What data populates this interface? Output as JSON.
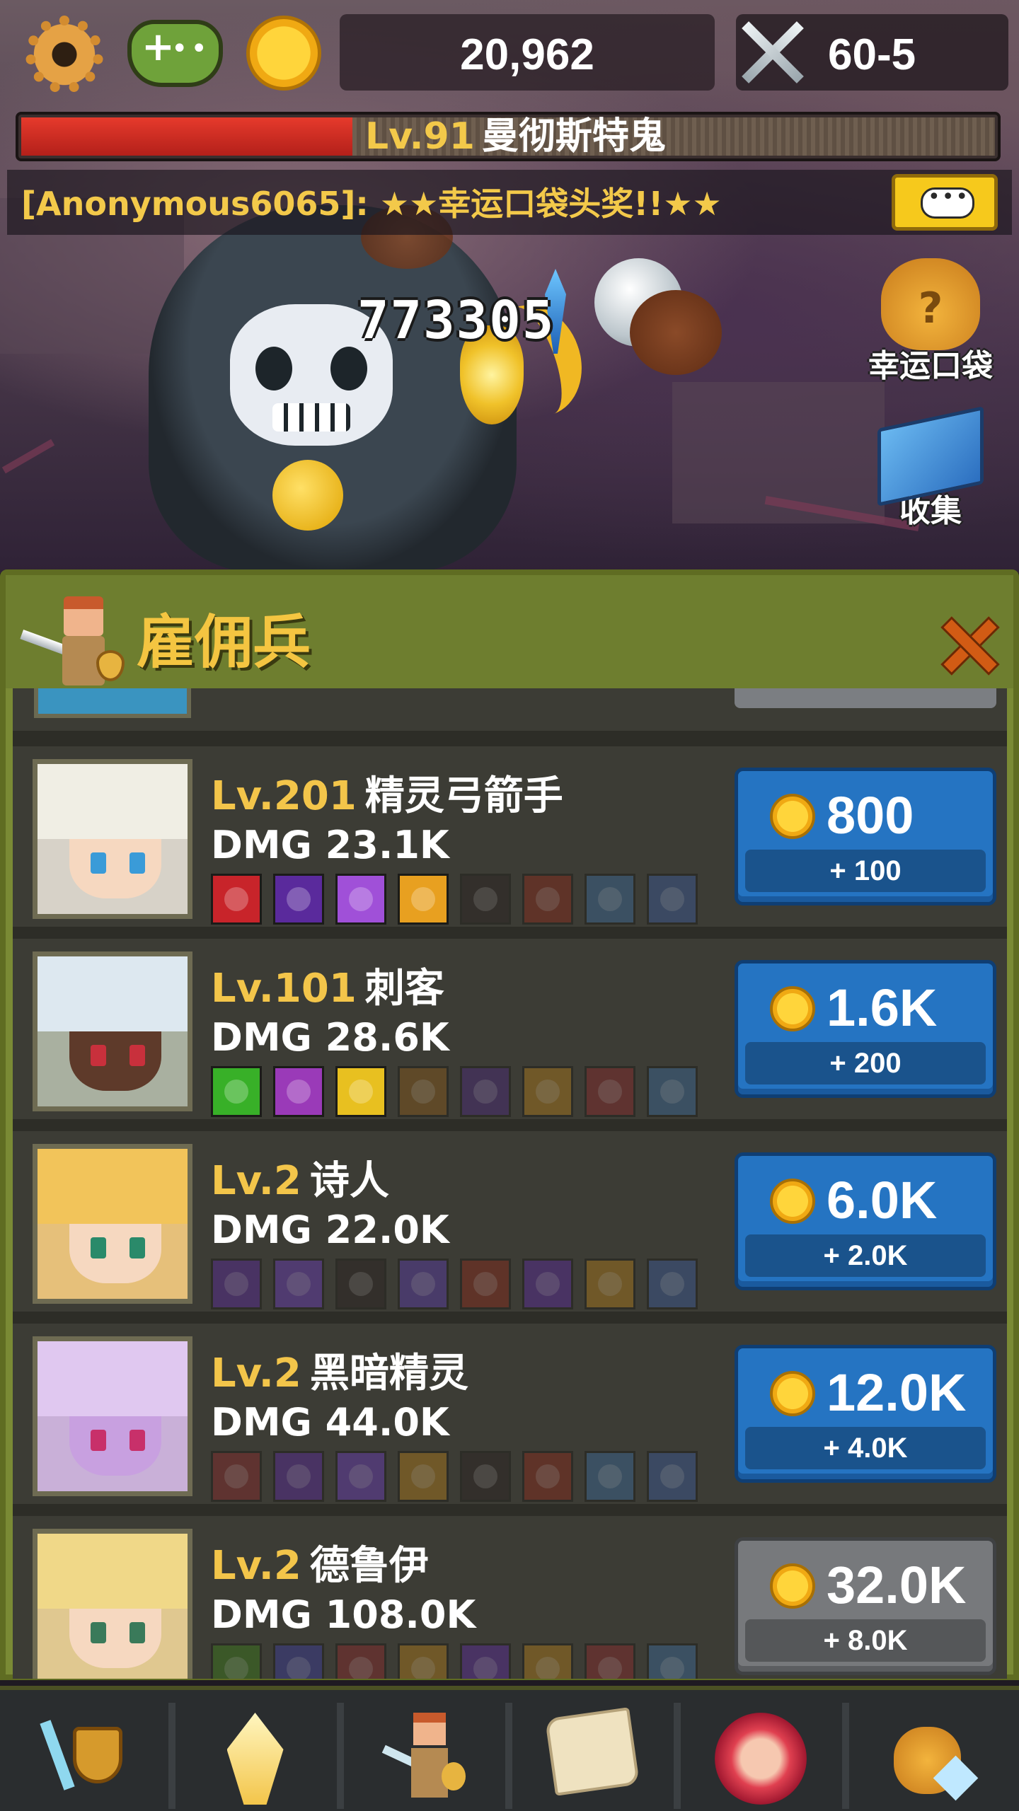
{
  "colors": {
    "accent_gold": "#f3c54a",
    "button_blue": "#2574c2",
    "button_disabled": "#77797c",
    "panel_green": "#7a8a35",
    "hp_red": "#e63a2c"
  },
  "topbar": {
    "settings_icon": "gear-icon",
    "games_icon": "gamepad-icon",
    "gold_icon": "gold-coin-icon",
    "gold_amount": "20,962",
    "stage_icon": "crossed-swords-icon",
    "stage": "60-5"
  },
  "boss": {
    "level": "Lv.91",
    "name": "曼彻斯特鬼",
    "hp_fraction": 0.34
  },
  "chat": {
    "message": "[Anonymous6065]: ★★幸运口袋头奖!!★★",
    "button_icon": "chat-bubble-icon"
  },
  "battle": {
    "damage_number": "773305"
  },
  "side_buttons": {
    "lucky_bag_label": "幸运口袋",
    "lucky_bag_icon": "lucky-bag-icon",
    "collection_label": "收集",
    "collection_icon": "book-icon"
  },
  "panel": {
    "title": "雇佣兵",
    "close_icon": "close-icon",
    "mercenaries": [
      {
        "level": "Lv.201",
        "name": "精灵弓箭手",
        "dmg": "DMG 23.1K",
        "cost": "800",
        "increment": "+ 100",
        "affordable": true,
        "skills": [
          {
            "color": "#c8242a",
            "active": true
          },
          {
            "color": "#5a2a9c",
            "active": true
          },
          {
            "color": "#a050d8",
            "active": true
          },
          {
            "color": "#e8a020",
            "active": true
          },
          {
            "color": "#2a2020",
            "active": false
          },
          {
            "color": "#8a2a1a",
            "active": false
          },
          {
            "color": "#3a6a9a",
            "active": false
          },
          {
            "color": "#3a5a9a",
            "active": false
          }
        ]
      },
      {
        "level": "Lv.101",
        "name": "刺客",
        "dmg": "DMG 28.6K",
        "cost": "1.6K",
        "increment": "+ 200",
        "affordable": true,
        "skills": [
          {
            "color": "#38b028",
            "active": true
          },
          {
            "color": "#9a3ab8",
            "active": true
          },
          {
            "color": "#e8c020",
            "active": true
          },
          {
            "color": "#8a5a1a",
            "active": false
          },
          {
            "color": "#4a2a7a",
            "active": false
          },
          {
            "color": "#b07a1a",
            "active": false
          },
          {
            "color": "#8a2a2a",
            "active": false
          },
          {
            "color": "#3a6a9a",
            "active": false
          }
        ]
      },
      {
        "level": "Lv.2",
        "name": "诗人",
        "dmg": "DMG 22.0K",
        "cost": "6.0K",
        "increment": "+ 2.0K",
        "affordable": true,
        "skills": [
          {
            "color": "#5a2a9c",
            "active": false
          },
          {
            "color": "#6a3ab8",
            "active": false
          },
          {
            "color": "#2a2020",
            "active": false
          },
          {
            "color": "#5a3aa8",
            "active": false
          },
          {
            "color": "#8a2a1a",
            "active": false
          },
          {
            "color": "#5a2a9c",
            "active": false
          },
          {
            "color": "#b07a1a",
            "active": false
          },
          {
            "color": "#3a5a9a",
            "active": false
          }
        ]
      },
      {
        "level": "Lv.2",
        "name": "黑暗精灵",
        "dmg": "DMG 44.0K",
        "cost": "12.0K",
        "increment": "+ 4.0K",
        "affordable": true,
        "skills": [
          {
            "color": "#8a2a2a",
            "active": false
          },
          {
            "color": "#5a2a9c",
            "active": false
          },
          {
            "color": "#6a3ab8",
            "active": false
          },
          {
            "color": "#b07a1a",
            "active": false
          },
          {
            "color": "#2a2020",
            "active": false
          },
          {
            "color": "#8a2a1a",
            "active": false
          },
          {
            "color": "#3a6a9a",
            "active": false
          },
          {
            "color": "#3a5a9a",
            "active": false
          }
        ]
      },
      {
        "level": "Lv.2",
        "name": "德鲁伊",
        "dmg": "DMG 108.0K",
        "cost": "32.0K",
        "increment": "+ 8.0K",
        "affordable": false,
        "skills": [
          {
            "color": "#3a7a1a",
            "active": false
          },
          {
            "color": "#3a3a9c",
            "active": false
          },
          {
            "color": "#8a2a2a",
            "active": false
          },
          {
            "color": "#b07a1a",
            "active": false
          },
          {
            "color": "#5a2a9c",
            "active": false
          },
          {
            "color": "#b07a1a",
            "active": false
          },
          {
            "color": "#8a2a2a",
            "active": false
          },
          {
            "color": "#3a6a9a",
            "active": false
          }
        ]
      }
    ]
  },
  "bottom_nav": [
    {
      "icon": "sword-shield-icon"
    },
    {
      "icon": "holy-sword-icon"
    },
    {
      "icon": "mercenary-icon"
    },
    {
      "icon": "scroll-icon"
    },
    {
      "icon": "fire-spirit-icon"
    },
    {
      "icon": "treasure-bag-icon"
    }
  ]
}
